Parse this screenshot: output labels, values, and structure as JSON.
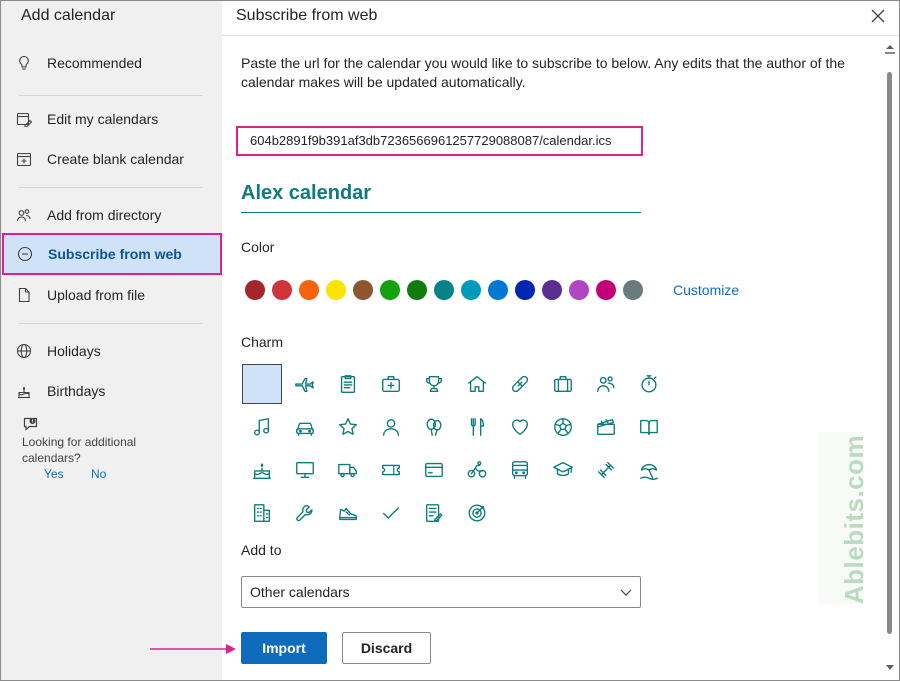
{
  "sidebar": {
    "title": "Add calendar",
    "items": [
      {
        "label": "Recommended",
        "icon": "lightbulb-icon"
      },
      {
        "label": "Edit my calendars",
        "icon": "edit-calendar-icon"
      },
      {
        "label": "Create blank calendar",
        "icon": "add-calendar-icon"
      },
      {
        "label": "Add from directory",
        "icon": "people-icon"
      },
      {
        "label": "Subscribe from web",
        "icon": "globe-link-icon",
        "active": true
      },
      {
        "label": "Upload from file",
        "icon": "file-icon"
      },
      {
        "label": "Holidays",
        "icon": "globe-icon"
      },
      {
        "label": "Birthdays",
        "icon": "cake-icon"
      }
    ],
    "feedback": {
      "text": "Looking for additional calendars?",
      "yes": "Yes",
      "no": "No"
    }
  },
  "main": {
    "title": "Subscribe from web",
    "description": "Paste the url for the calendar you would like to subscribe to below. Any edits that the author of the calendar makes will be updated automatically.",
    "url_value": "604b2891f9b391af3db7236566961257729088087/calendar.ics",
    "calendar_name": "Alex calendar",
    "color_label": "Color",
    "colors": [
      "#a4262c",
      "#d13438",
      "#f7630c",
      "#fde300",
      "#8e562e",
      "#13a10e",
      "#107c10",
      "#038387",
      "#0099bc",
      "#0078d4",
      "#0027b4",
      "#5c2e91",
      "#b146c2",
      "#bf0077",
      "#69797e"
    ],
    "customize_label": "Customize",
    "charm_label": "Charm",
    "charms": [
      "blank",
      "airplane",
      "clipboard",
      "first-aid",
      "trophy",
      "home",
      "bandage",
      "briefcase",
      "people",
      "stopwatch",
      "music",
      "car",
      "star",
      "person",
      "balloons",
      "fork-knife",
      "heart",
      "soccer-ball",
      "clapperboard",
      "book",
      "cake",
      "monitor",
      "truck",
      "ticket",
      "credit-card",
      "cyclist",
      "bus",
      "graduation-cap",
      "dumbbell",
      "beach",
      "building",
      "wrench",
      "sneaker",
      "checkmark",
      "notepad",
      "target"
    ],
    "add_to_label": "Add to",
    "add_to_value": "Other calendars",
    "import_label": "Import",
    "discard_label": "Discard"
  },
  "watermark": "Ablebits.com",
  "accent_color": "#e0218a",
  "theme_color": "#0e7c7b"
}
